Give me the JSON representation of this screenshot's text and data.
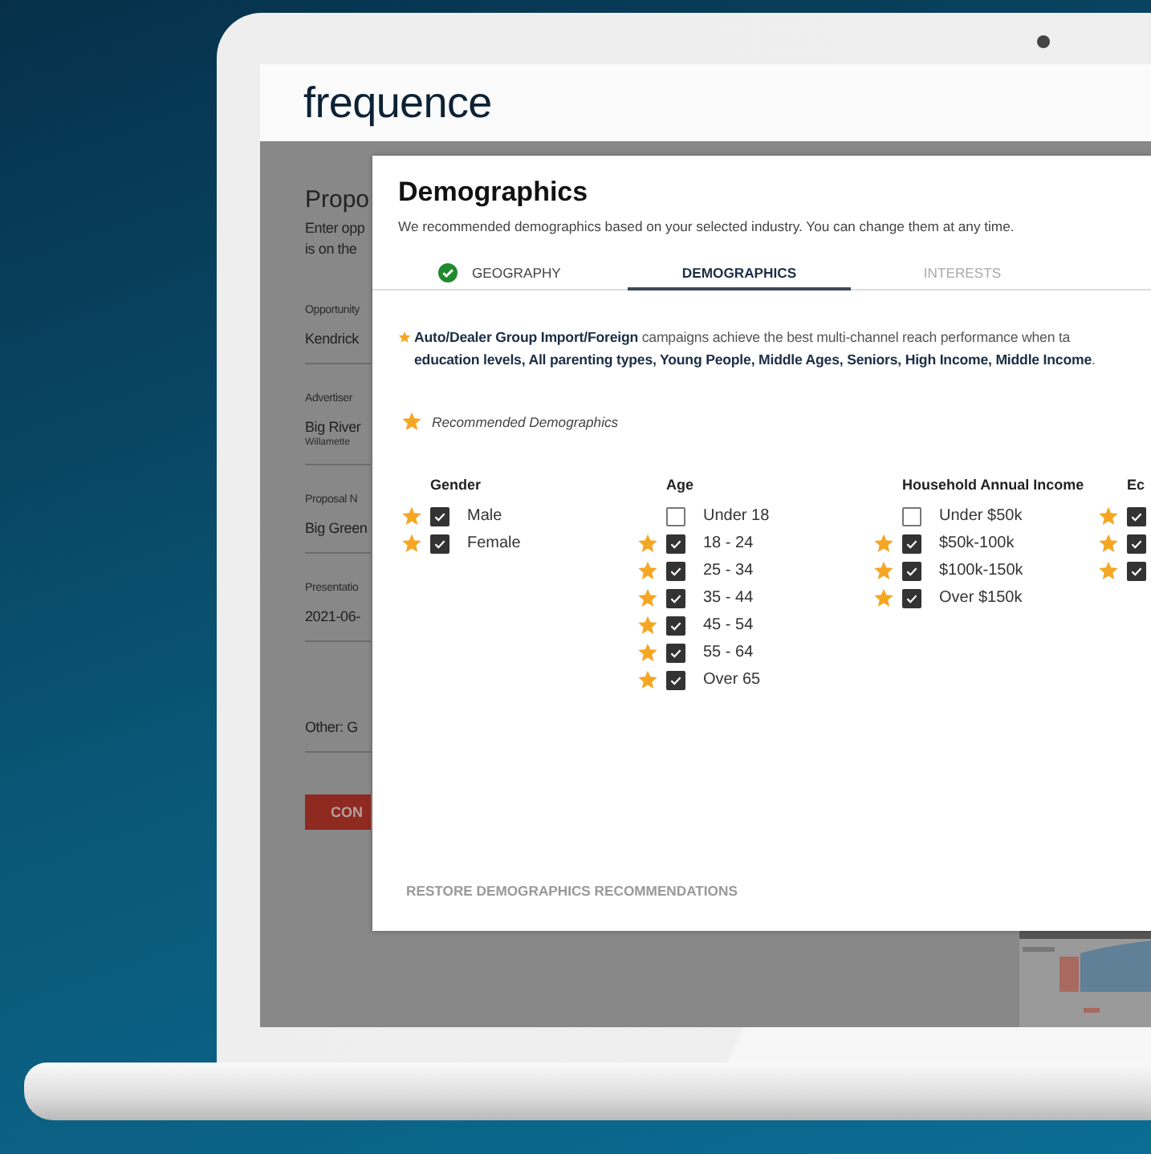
{
  "app": {
    "logo": "frequence"
  },
  "background_form": {
    "title": "Propo",
    "description_lines": [
      "Enter opp",
      "is on the"
    ],
    "fields": [
      {
        "label": "Opportunity",
        "value": "Kendrick"
      },
      {
        "label": "Advertiser",
        "value": "Big River",
        "sublabel": "Willamette"
      },
      {
        "label": "Proposal N",
        "value": "Big Green"
      },
      {
        "label": "Presentatio",
        "value": "2021-06-"
      },
      {
        "value": "Other: G"
      }
    ],
    "button": "CON"
  },
  "dialog": {
    "title": "Demographics",
    "subtitle": "We recommended demographics based on your selected industry. You can change them at any time.",
    "tabs": [
      {
        "label": "GEOGRAPHY",
        "selected": false,
        "completed": true,
        "disabled": false
      },
      {
        "label": "DEMOGRAPHICS",
        "selected": true,
        "completed": false,
        "disabled": false
      },
      {
        "label": "INTERESTS",
        "selected": false,
        "completed": false,
        "disabled": true
      }
    ],
    "intro": "**Auto/Dealer Group Import/Foreign** campaigns achieve the best multi-channel reach performance when ta\n**education levels, All parenting types, Young People, Middle Ages, Seniors, High Income, Middle Income**.",
    "legend": "Recommended Demographics",
    "groups": [
      {
        "title": "Gender",
        "options": [
          {
            "label": "Male",
            "checked": true,
            "recommended": true
          },
          {
            "label": "Female",
            "checked": true,
            "recommended": true
          }
        ]
      },
      {
        "title": "Age",
        "options": [
          {
            "label": "Under 18",
            "checked": false,
            "recommended": false
          },
          {
            "label": "18 - 24",
            "checked": true,
            "recommended": true
          },
          {
            "label": "25 - 34",
            "checked": true,
            "recommended": true
          },
          {
            "label": "35 - 44",
            "checked": true,
            "recommended": true
          },
          {
            "label": "45 - 54",
            "checked": true,
            "recommended": true
          },
          {
            "label": "55 - 64",
            "checked": true,
            "recommended": true
          },
          {
            "label": "Over 65",
            "checked": true,
            "recommended": true
          }
        ]
      },
      {
        "title": "Household Annual Income",
        "options": [
          {
            "label": "Under $50k",
            "checked": false,
            "recommended": false
          },
          {
            "label": "$50k-100k",
            "checked": true,
            "recommended": true
          },
          {
            "label": "$100k-150k",
            "checked": true,
            "recommended": true
          },
          {
            "label": "Over $150k",
            "checked": true,
            "recommended": true
          }
        ]
      },
      {
        "title": "Ec",
        "options": [
          {
            "checked": true,
            "recommended": true
          },
          {
            "checked": true,
            "recommended": true
          },
          {
            "checked": true,
            "recommended": true
          }
        ]
      }
    ],
    "restore_button": "RESTORE DEMOGRAPHICS RECOMMENDATIONS"
  }
}
